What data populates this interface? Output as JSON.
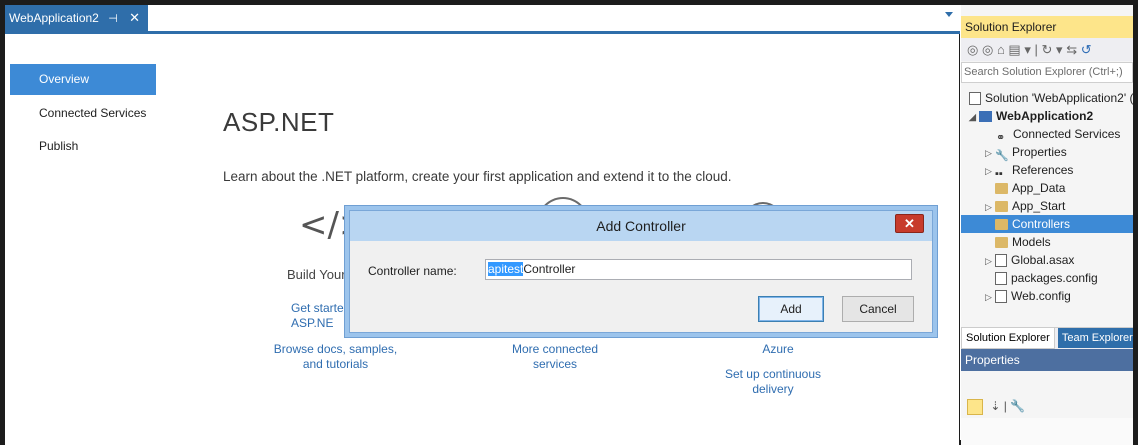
{
  "document_tab": {
    "title": "WebApplication2",
    "pin_glyph": "⊣",
    "close_glyph": "✕"
  },
  "nav": {
    "overview": "Overview",
    "connected_services": "Connected Services",
    "publish": "Publish"
  },
  "main": {
    "title": "ASP.NET",
    "subtitle": "Learn about the .NET platform, create your first application and extend it to the cloud.",
    "code_icon_glyph": "</>",
    "build_your": "Build Your",
    "get_started_line1": "Get started",
    "get_started_line2": "ASP.NE",
    "browse_line1": "Browse docs, samples,",
    "browse_line2": "and tutorials",
    "more_connected_line1": "More connected",
    "more_connected_line2": "services",
    "azure": "Azure",
    "setup_line1": "Set up continuous",
    "setup_line2": "delivery"
  },
  "dialog": {
    "title": "Add Controller",
    "close_glyph": "✕",
    "controller_name_label": "Controller name:",
    "input_selected_text": "apitest",
    "input_rest_text": "Controller",
    "add_label": "Add",
    "cancel_label": "Cancel"
  },
  "solution_explorer": {
    "title": "Solution Explorer",
    "search_placeholder": "Search Solution Explorer (Ctrl+;)",
    "tree": {
      "solution": "Solution 'WebApplication2' (",
      "project": "WebApplication2",
      "connected_services": "Connected Services",
      "properties": "Properties",
      "references": "References",
      "app_data": "App_Data",
      "app_start": "App_Start",
      "controllers": "Controllers",
      "models": "Models",
      "global_asax": "Global.asax",
      "packages_config": "packages.config",
      "web_config": "Web.config"
    },
    "tab_solution_explorer": "Solution Explorer",
    "tab_team_explorer": "Team Explorer"
  },
  "properties": {
    "title": "Properties"
  },
  "colors": {
    "accent": "#3d8ad6",
    "tab_blue": "#2f6eaa",
    "link": "#2f6db0",
    "se_title": "#fde58a"
  }
}
